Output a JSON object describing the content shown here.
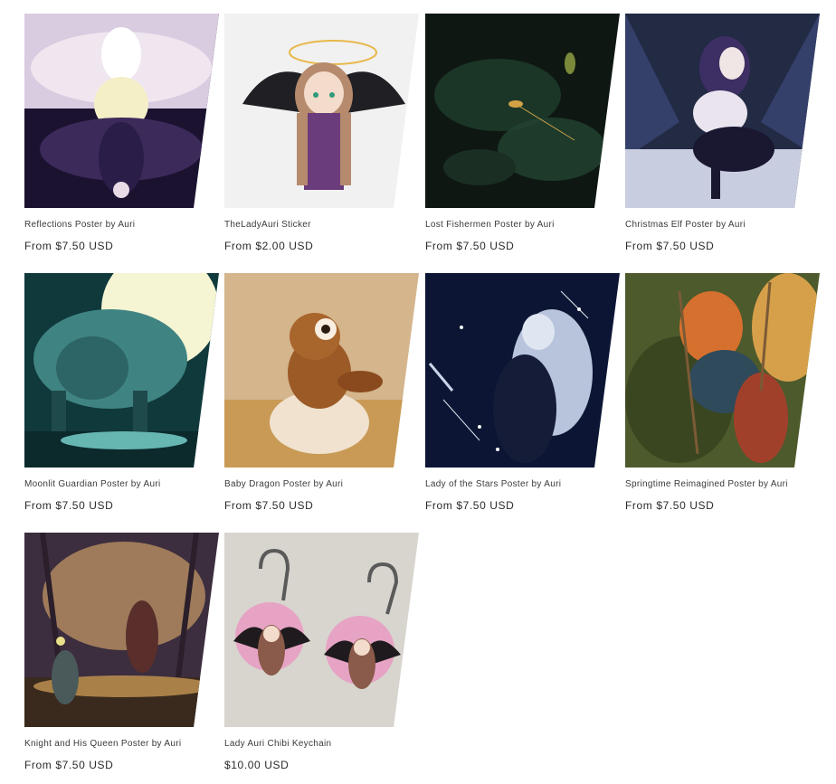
{
  "products": [
    {
      "title": "Reflections Poster by Auri",
      "price": "From $7.50 USD",
      "image": "reflections-artwork",
      "colors": [
        "#1b1230",
        "#e8dbe6",
        "#3b2a5a"
      ]
    },
    {
      "title": "TheLadyAuri Sticker",
      "price": "From $2.00 USD",
      "image": "sticker-artwork",
      "colors": [
        "#f2f2f2",
        "#7a3f8c",
        "#c8a07a"
      ]
    },
    {
      "title": "Lost Fishermen Poster by Auri",
      "price": "From $7.50 USD",
      "image": "lost-fishermen-artwork",
      "colors": [
        "#0e1a14",
        "#2f5a3f",
        "#c9a24a"
      ]
    },
    {
      "title": "Christmas Elf Poster by Auri",
      "price": "From $7.50 USD",
      "image": "christmas-elf-artwork",
      "colors": [
        "#20283e",
        "#5a4a7a",
        "#e8e6f0"
      ]
    },
    {
      "title": "Moonlit Guardian Poster by Auri",
      "price": "From $7.50 USD",
      "image": "moonlit-guardian-artwork",
      "colors": [
        "#143f42",
        "#6fb7b3",
        "#fdfbd6"
      ]
    },
    {
      "title": "Baby Dragon Poster by Auri",
      "price": "From $7.50 USD",
      "image": "baby-dragon-artwork",
      "colors": [
        "#d9b98a",
        "#a45a25",
        "#f1dcc0"
      ]
    },
    {
      "title": "Lady of the Stars Poster by Auri",
      "price": "From $7.50 USD",
      "image": "lady-of-stars-artwork",
      "colors": [
        "#0c1733",
        "#c9d4e8",
        "#1b2a52"
      ]
    },
    {
      "title": "Springtime Reimagined Poster by Auri",
      "price": "From $7.50 USD",
      "image": "springtime-artwork",
      "colors": [
        "#4b5a2a",
        "#d6702e",
        "#9e3b23"
      ]
    },
    {
      "title": "Knight and His Queen Poster by Auri",
      "price": "From $7.50 USD",
      "image": "knight-queen-artwork",
      "colors": [
        "#3e2e3c",
        "#b58a5a",
        "#d9a860"
      ]
    },
    {
      "title": "Lady Auri Chibi Keychain",
      "price": "$10.00 USD",
      "image": "keychain-photo",
      "colors": [
        "#d7d3cd",
        "#e6a3c4",
        "#2a2326"
      ]
    }
  ]
}
